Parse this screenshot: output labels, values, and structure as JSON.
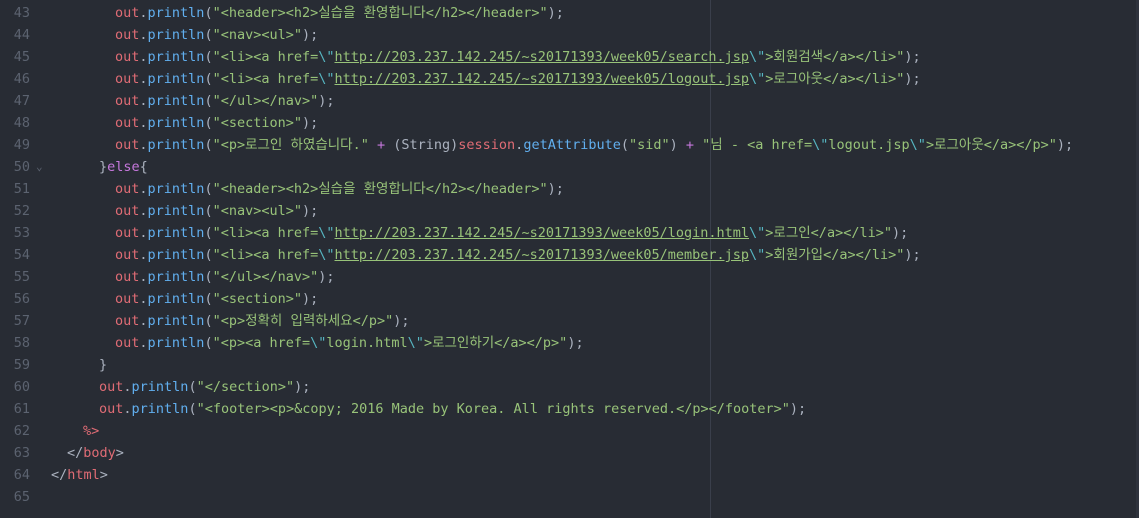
{
  "lines": [
    {
      "n": "43",
      "indent": 8,
      "fold": "",
      "tokens": [
        {
          "t": "out",
          "c": "obj"
        },
        {
          "t": ".",
          "c": "pun"
        },
        {
          "t": "println",
          "c": "fn"
        },
        {
          "t": "(",
          "c": "pun"
        },
        {
          "t": "\"<header><h2>실습을 환영합니다</h2></header>\"",
          "c": "str"
        },
        {
          "t": ");",
          "c": "pun"
        }
      ]
    },
    {
      "n": "44",
      "indent": 8,
      "fold": "",
      "tokens": [
        {
          "t": "out",
          "c": "obj"
        },
        {
          "t": ".",
          "c": "pun"
        },
        {
          "t": "println",
          "c": "fn"
        },
        {
          "t": "(",
          "c": "pun"
        },
        {
          "t": "\"<nav><ul>\"",
          "c": "str"
        },
        {
          "t": ");",
          "c": "pun"
        }
      ]
    },
    {
      "n": "45",
      "indent": 8,
      "fold": "",
      "tokens": [
        {
          "t": "out",
          "c": "obj"
        },
        {
          "t": ".",
          "c": "pun"
        },
        {
          "t": "println",
          "c": "fn"
        },
        {
          "t": "(",
          "c": "pun"
        },
        {
          "t": "\"<li><a href=",
          "c": "str"
        },
        {
          "t": "\\\"",
          "c": "esc"
        },
        {
          "t": "http://203.237.142.245/~s20171393/week05/search.jsp",
          "c": "url"
        },
        {
          "t": "\\\"",
          "c": "esc"
        },
        {
          "t": ">회원검색</a></li>\"",
          "c": "str"
        },
        {
          "t": ");",
          "c": "pun"
        }
      ]
    },
    {
      "n": "46",
      "indent": 8,
      "fold": "",
      "tokens": [
        {
          "t": "out",
          "c": "obj"
        },
        {
          "t": ".",
          "c": "pun"
        },
        {
          "t": "println",
          "c": "fn"
        },
        {
          "t": "(",
          "c": "pun"
        },
        {
          "t": "\"<li><a href=",
          "c": "str"
        },
        {
          "t": "\\\"",
          "c": "esc"
        },
        {
          "t": "http://203.237.142.245/~s20171393/week05/logout.jsp",
          "c": "url"
        },
        {
          "t": "\\\"",
          "c": "esc"
        },
        {
          "t": ">로그아웃</a></li>\"",
          "c": "str"
        },
        {
          "t": ");",
          "c": "pun"
        }
      ]
    },
    {
      "n": "47",
      "indent": 8,
      "fold": "",
      "tokens": [
        {
          "t": "out",
          "c": "obj"
        },
        {
          "t": ".",
          "c": "pun"
        },
        {
          "t": "println",
          "c": "fn"
        },
        {
          "t": "(",
          "c": "pun"
        },
        {
          "t": "\"</ul></nav>\"",
          "c": "str"
        },
        {
          "t": ");",
          "c": "pun"
        }
      ]
    },
    {
      "n": "48",
      "indent": 8,
      "fold": "",
      "tokens": [
        {
          "t": "out",
          "c": "obj"
        },
        {
          "t": ".",
          "c": "pun"
        },
        {
          "t": "println",
          "c": "fn"
        },
        {
          "t": "(",
          "c": "pun"
        },
        {
          "t": "\"<section>\"",
          "c": "str"
        },
        {
          "t": ");",
          "c": "pun"
        }
      ]
    },
    {
      "n": "49",
      "indent": 8,
      "fold": "",
      "tokens": [
        {
          "t": "out",
          "c": "obj"
        },
        {
          "t": ".",
          "c": "pun"
        },
        {
          "t": "println",
          "c": "fn"
        },
        {
          "t": "(",
          "c": "pun"
        },
        {
          "t": "\"<p>로그인 하였습니다.\"",
          "c": "str"
        },
        {
          "t": " + ",
          "c": "op"
        },
        {
          "t": "(String)",
          "c": "cls"
        },
        {
          "t": "session",
          "c": "obj"
        },
        {
          "t": ".",
          "c": "pun"
        },
        {
          "t": "getAttribute",
          "c": "fn"
        },
        {
          "t": "(",
          "c": "pun"
        },
        {
          "t": "\"sid\"",
          "c": "str"
        },
        {
          "t": ")",
          "c": "pun"
        },
        {
          "t": " + ",
          "c": "op"
        },
        {
          "t": "\"님 - <a href=",
          "c": "str"
        },
        {
          "t": "\\\"",
          "c": "esc"
        },
        {
          "t": "logout.jsp",
          "c": "str"
        },
        {
          "t": "\\\"",
          "c": "esc"
        },
        {
          "t": ">로그아웃</a></p>\"",
          "c": "str"
        },
        {
          "t": ");",
          "c": "pun"
        }
      ]
    },
    {
      "n": "50",
      "indent": 6,
      "fold": "⌄",
      "tokens": [
        {
          "t": "}",
          "c": "pun"
        },
        {
          "t": "else",
          "c": "kw"
        },
        {
          "t": "{",
          "c": "pun"
        }
      ]
    },
    {
      "n": "51",
      "indent": 8,
      "fold": "",
      "tokens": [
        {
          "t": "out",
          "c": "obj"
        },
        {
          "t": ".",
          "c": "pun"
        },
        {
          "t": "println",
          "c": "fn"
        },
        {
          "t": "(",
          "c": "pun"
        },
        {
          "t": "\"<header><h2>실습을 환영합니다</h2></header>\"",
          "c": "str"
        },
        {
          "t": ");",
          "c": "pun"
        }
      ]
    },
    {
      "n": "52",
      "indent": 8,
      "fold": "",
      "tokens": [
        {
          "t": "out",
          "c": "obj"
        },
        {
          "t": ".",
          "c": "pun"
        },
        {
          "t": "println",
          "c": "fn"
        },
        {
          "t": "(",
          "c": "pun"
        },
        {
          "t": "\"<nav><ul>\"",
          "c": "str"
        },
        {
          "t": ");",
          "c": "pun"
        }
      ]
    },
    {
      "n": "53",
      "indent": 8,
      "fold": "",
      "tokens": [
        {
          "t": "out",
          "c": "obj"
        },
        {
          "t": ".",
          "c": "pun"
        },
        {
          "t": "println",
          "c": "fn"
        },
        {
          "t": "(",
          "c": "pun"
        },
        {
          "t": "\"<li><a href=",
          "c": "str"
        },
        {
          "t": "\\\"",
          "c": "esc"
        },
        {
          "t": "http://203.237.142.245/~s20171393/week05/login.html",
          "c": "url"
        },
        {
          "t": "\\\"",
          "c": "esc"
        },
        {
          "t": ">로그인</a></li>\"",
          "c": "str"
        },
        {
          "t": ");",
          "c": "pun"
        }
      ]
    },
    {
      "n": "54",
      "indent": 8,
      "fold": "",
      "tokens": [
        {
          "t": "out",
          "c": "obj"
        },
        {
          "t": ".",
          "c": "pun"
        },
        {
          "t": "println",
          "c": "fn"
        },
        {
          "t": "(",
          "c": "pun"
        },
        {
          "t": "\"<li><a href=",
          "c": "str"
        },
        {
          "t": "\\\"",
          "c": "esc"
        },
        {
          "t": "http://203.237.142.245/~s20171393/week05/member.jsp",
          "c": "url"
        },
        {
          "t": "\\\"",
          "c": "esc"
        },
        {
          "t": ">회원가입</a></li>\"",
          "c": "str"
        },
        {
          "t": ");",
          "c": "pun"
        }
      ]
    },
    {
      "n": "55",
      "indent": 8,
      "fold": "",
      "tokens": [
        {
          "t": "out",
          "c": "obj"
        },
        {
          "t": ".",
          "c": "pun"
        },
        {
          "t": "println",
          "c": "fn"
        },
        {
          "t": "(",
          "c": "pun"
        },
        {
          "t": "\"</ul></nav>\"",
          "c": "str"
        },
        {
          "t": ");",
          "c": "pun"
        }
      ]
    },
    {
      "n": "56",
      "indent": 8,
      "fold": "",
      "tokens": [
        {
          "t": "out",
          "c": "obj"
        },
        {
          "t": ".",
          "c": "pun"
        },
        {
          "t": "println",
          "c": "fn"
        },
        {
          "t": "(",
          "c": "pun"
        },
        {
          "t": "\"<section>\"",
          "c": "str"
        },
        {
          "t": ");",
          "c": "pun"
        }
      ]
    },
    {
      "n": "57",
      "indent": 8,
      "fold": "",
      "tokens": [
        {
          "t": "out",
          "c": "obj"
        },
        {
          "t": ".",
          "c": "pun"
        },
        {
          "t": "println",
          "c": "fn"
        },
        {
          "t": "(",
          "c": "pun"
        },
        {
          "t": "\"<p>정확히 입력하세요</p>\"",
          "c": "str"
        },
        {
          "t": ");",
          "c": "pun"
        }
      ]
    },
    {
      "n": "58",
      "indent": 8,
      "fold": "",
      "tokens": [
        {
          "t": "out",
          "c": "obj"
        },
        {
          "t": ".",
          "c": "pun"
        },
        {
          "t": "println",
          "c": "fn"
        },
        {
          "t": "(",
          "c": "pun"
        },
        {
          "t": "\"<p><a href=",
          "c": "str"
        },
        {
          "t": "\\\"",
          "c": "esc"
        },
        {
          "t": "login.html",
          "c": "str"
        },
        {
          "t": "\\\"",
          "c": "esc"
        },
        {
          "t": ">로그인하기</a></p>\"",
          "c": "str"
        },
        {
          "t": ");",
          "c": "pun"
        }
      ]
    },
    {
      "n": "59",
      "indent": 6,
      "fold": "",
      "tokens": [
        {
          "t": "}",
          "c": "pun"
        }
      ]
    },
    {
      "n": "60",
      "indent": 6,
      "fold": "",
      "tokens": [
        {
          "t": "out",
          "c": "obj"
        },
        {
          "t": ".",
          "c": "pun"
        },
        {
          "t": "println",
          "c": "fn"
        },
        {
          "t": "(",
          "c": "pun"
        },
        {
          "t": "\"</section>\"",
          "c": "str"
        },
        {
          "t": ");",
          "c": "pun"
        }
      ]
    },
    {
      "n": "61",
      "indent": 6,
      "fold": "",
      "tokens": [
        {
          "t": "out",
          "c": "obj"
        },
        {
          "t": ".",
          "c": "pun"
        },
        {
          "t": "println",
          "c": "fn"
        },
        {
          "t": "(",
          "c": "pun"
        },
        {
          "t": "\"<footer><p>&copy; 2016 Made by Korea. All rights reserved.</p></footer>\"",
          "c": "str"
        },
        {
          "t": ");",
          "c": "pun"
        }
      ]
    },
    {
      "n": "62",
      "indent": 4,
      "fold": "",
      "tokens": [
        {
          "t": "%>",
          "c": "jsp"
        }
      ]
    },
    {
      "n": "63",
      "indent": 2,
      "fold": "",
      "tokens": [
        {
          "t": "</",
          "c": "plain"
        },
        {
          "t": "body",
          "c": "tag"
        },
        {
          "t": ">",
          "c": "plain"
        }
      ]
    },
    {
      "n": "64",
      "indent": 0,
      "fold": "",
      "tokens": [
        {
          "t": "</",
          "c": "plain"
        },
        {
          "t": "html",
          "c": "tag"
        },
        {
          "t": ">",
          "c": "plain"
        }
      ]
    },
    {
      "n": "65",
      "indent": 0,
      "fold": "",
      "tokens": []
    }
  ],
  "colors": {
    "background": "#282c34",
    "line_number": "#5c6370",
    "object": "#e06c75",
    "function": "#61afef",
    "string": "#98c379",
    "escape": "#56b6c2",
    "keyword": "#c678dd"
  }
}
